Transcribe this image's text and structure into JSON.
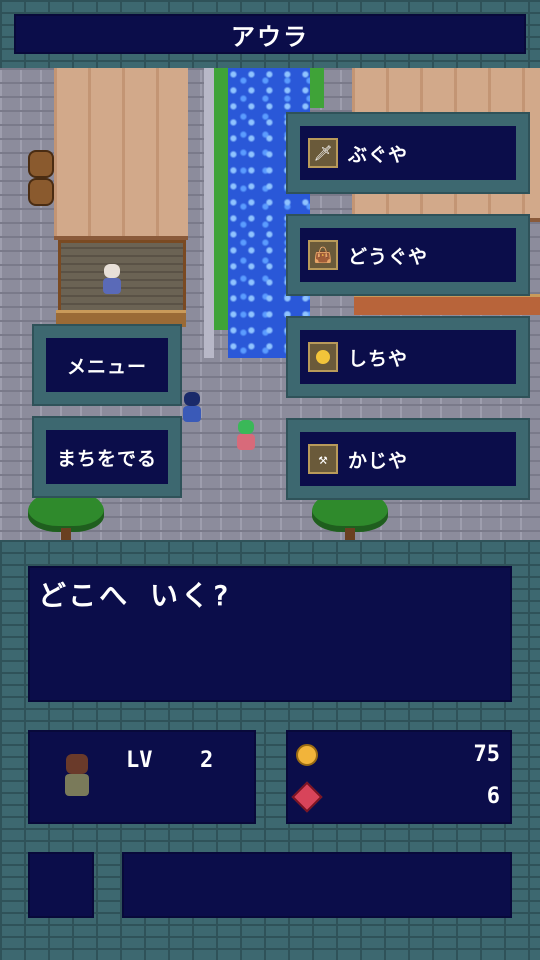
{
  "header": {
    "town_name": "アウラ"
  },
  "shops": [
    {
      "label": "ぶぐや",
      "icon": "sword-icon"
    },
    {
      "label": "どうぐや",
      "icon": "bag-icon"
    },
    {
      "label": "しちや",
      "icon": "coin-icon"
    },
    {
      "label": "かじや",
      "icon": "anvil-icon"
    }
  ],
  "side_buttons": {
    "menu_label": "メニュー",
    "leave_label": "まちをでる"
  },
  "message": {
    "text": "どこへ いく?"
  },
  "status": {
    "level_label": "LV",
    "level_value": "2",
    "gold": "75",
    "gems": "6"
  },
  "colors": {
    "panel": "#0b0d4a",
    "frame": "#3d6870",
    "gold_icon": "#f2b43a",
    "gem_icon": "#d8445a"
  }
}
